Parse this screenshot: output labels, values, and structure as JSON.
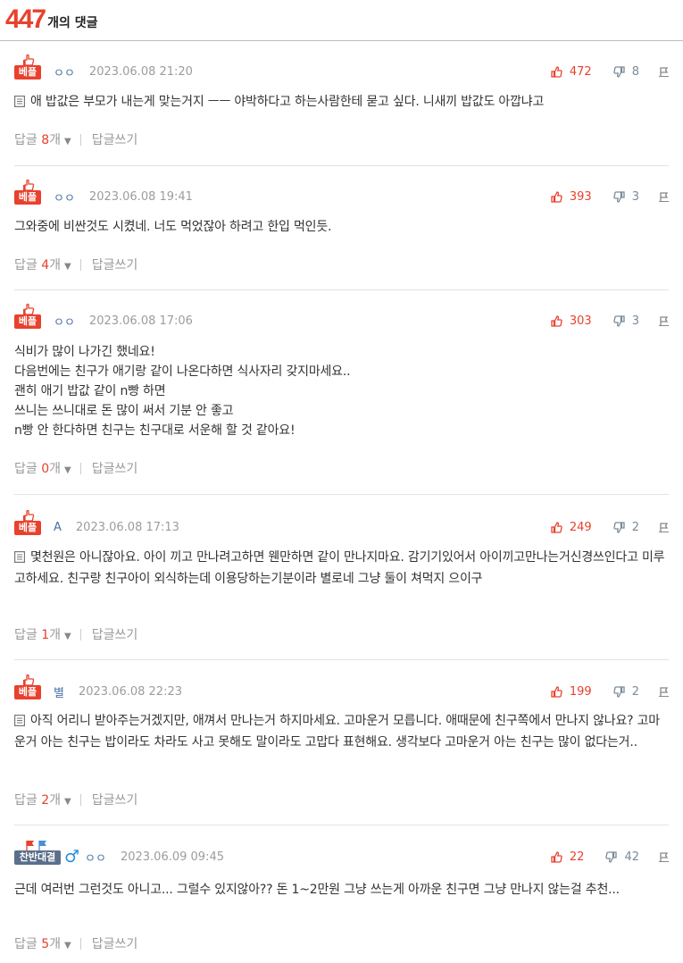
{
  "header": {
    "count": "447",
    "label": "개의 댓글"
  },
  "colors": {
    "accent": "#e8412d",
    "author": "#4a6fa5",
    "meta": "#9c9c9c"
  },
  "actions": {
    "reply_label": "답글",
    "count_unit": "개",
    "write_reply_label": "답글쓰기"
  },
  "comments": [
    {
      "badge": "베플",
      "badge_type": "best",
      "author": "ㅇㅇ",
      "date": "2023.06.08 21:20",
      "likes": "472",
      "dislikes": "8",
      "has_doc_icon": true,
      "text": "애 밥값은 부모가 내는게 맞는거지 ㅡㅡ 야박하다고 하는사람한테 묻고 싶다. 니새끼 밥값도 아깝냐고",
      "reply_count": "8"
    },
    {
      "badge": "베플",
      "badge_type": "best",
      "author": "ㅇㅇ",
      "date": "2023.06.08 19:41",
      "likes": "393",
      "dislikes": "3",
      "has_doc_icon": false,
      "text": "그와중에 비싼것도 시켰네. 너도 먹었잖아 하려고 한입 먹인듯.",
      "reply_count": "4"
    },
    {
      "badge": "베플",
      "badge_type": "best",
      "author": "ㅇㅇ",
      "date": "2023.06.08 17:06",
      "likes": "303",
      "dislikes": "3",
      "has_doc_icon": false,
      "text": "식비가 많이 나가긴 했네요!\n다음번에는 친구가 애기랑 같이 나온다하면 식사자리 갖지마세요..\n괜히 애기 밥값 같이 n빵 하면\n쓰니는 쓰니대로 돈 많이 써서 기분 안 좋고\nn빵 안 한다하면 친구는 친구대로 서운해 할 것 같아요!",
      "reply_count": "0"
    },
    {
      "badge": "베플",
      "badge_type": "best",
      "author": "A",
      "date": "2023.06.08 17:13",
      "likes": "249",
      "dislikes": "2",
      "has_doc_icon": true,
      "text": "몇천원은 아니잖아요. 아이 끼고 만나려고하면 웬만하면 같이 만나지마요. 감기기있어서 아이끼고만나는거신경쓰인다고 미루고하세요. 친구랑 친구아이 외식하는데 이용당하는기분이라 별로네 그냥 둘이 쳐먹지 으이구",
      "reply_count": "1"
    },
    {
      "badge": "베플",
      "badge_type": "best",
      "author": "별",
      "date": "2023.06.08 22:23",
      "likes": "199",
      "dislikes": "2",
      "has_doc_icon": true,
      "text": "아직 어리니 받아주는거겠지만, 애껴서 만나는거 하지마세요. 고마운거 모릅니다. 애때문에 친구쪽에서 만나지 않나요? 고마운거 아는 친구는 밥이라도 차라도 사고 못해도 말이라도 고맙다 표현해요. 생각보다 고마운거 아는 친구는 많이 없다는거..",
      "reply_count": "2"
    },
    {
      "badge": "찬반대결",
      "badge_type": "vs",
      "author": "ㅇㅇ",
      "gender": "♂",
      "date": "2023.06.09 09:45",
      "likes": "22",
      "dislikes": "42",
      "has_doc_icon": false,
      "text": "근데 여러번 그런것도 아니고... 그럴수 있지않아?? 돈 1~2만원 그냥 쓰는게 아까운 친구면 그냥 만나지 않는걸 추천...",
      "reply_count": "5"
    }
  ]
}
